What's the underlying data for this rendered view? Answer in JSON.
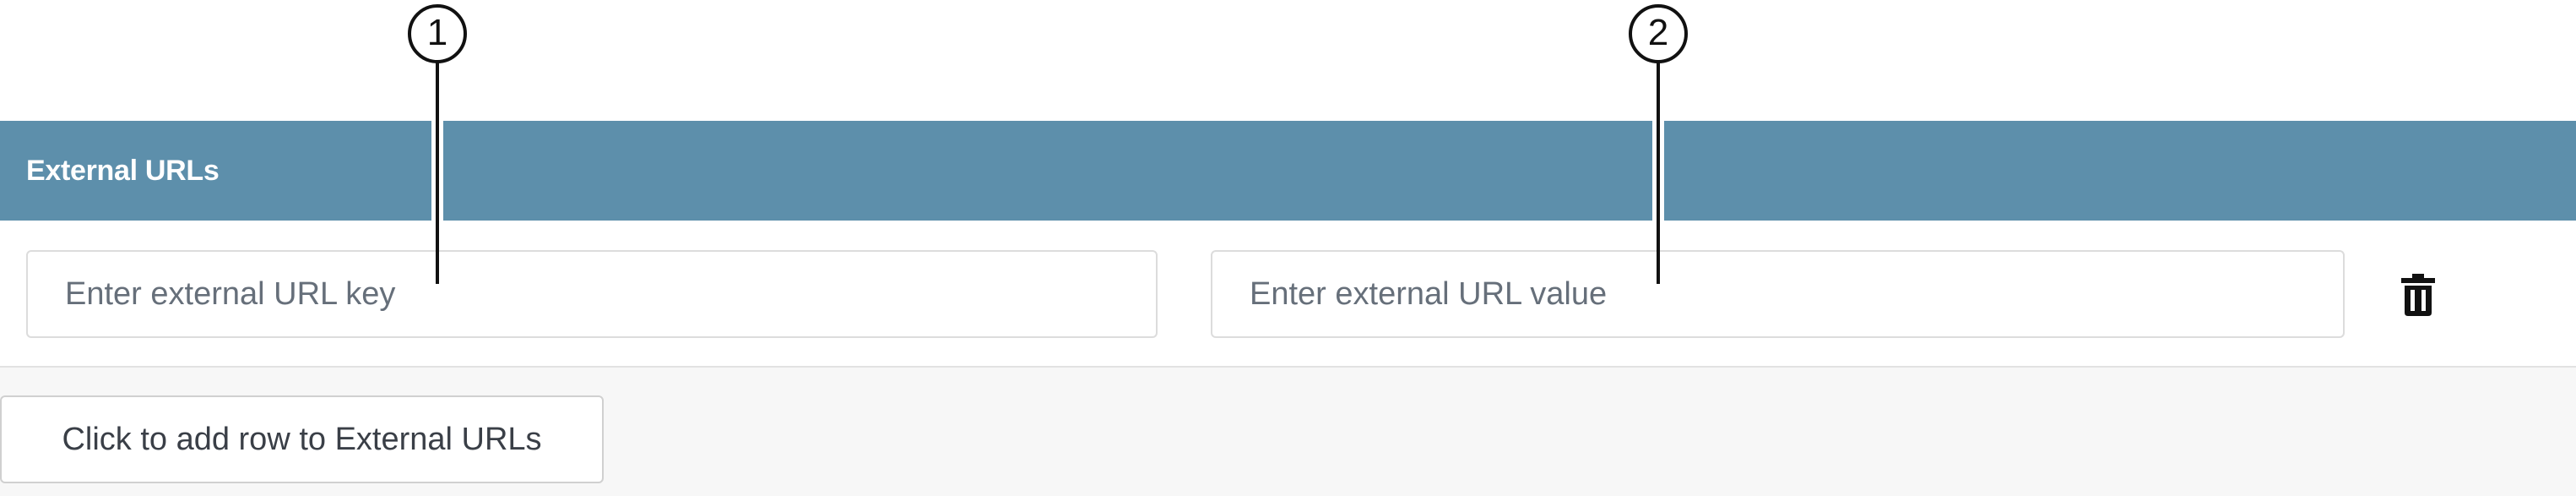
{
  "section": {
    "title": "External URLs"
  },
  "row": {
    "key_placeholder": "Enter external URL key",
    "value_placeholder": "Enter external URL value",
    "delete_icon": "trash-icon"
  },
  "add_row": {
    "label": "Click to add row to External URLs"
  },
  "callouts": [
    "1",
    "2"
  ],
  "colors": {
    "header": "#5d8fab",
    "footer": "#f7f7f7"
  }
}
